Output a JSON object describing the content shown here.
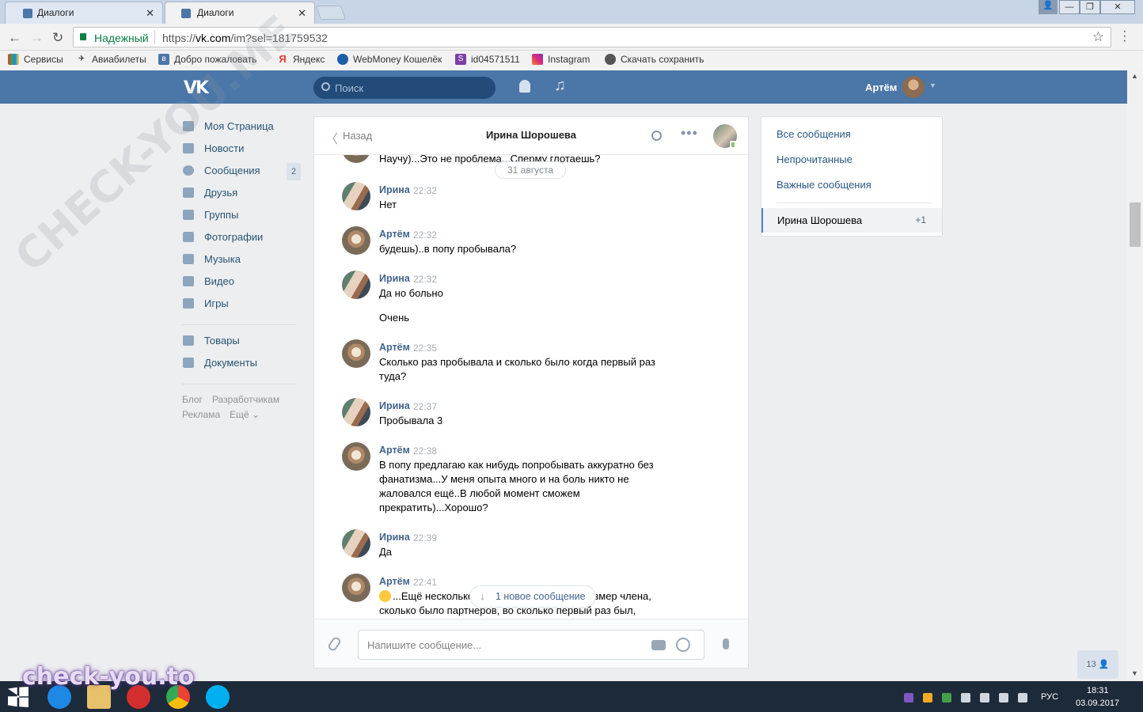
{
  "browser": {
    "tabs": [
      {
        "title": "Диалоги",
        "active": false
      },
      {
        "title": "Диалоги",
        "active": true
      }
    ],
    "secure_label": "Надежный",
    "url_scheme": "https://",
    "url_host": "vk.com",
    "url_path": "/im?sel=181759532",
    "bookmarks": [
      "Сервисы",
      "Авиабилеты",
      "Добро пожаловать",
      "Яндекс",
      "WebMoney Кошелёк",
      "id04571511",
      "Instagram",
      "Скачать сохранить"
    ]
  },
  "vk": {
    "search_placeholder": "Поиск",
    "username": "Артём",
    "menu": [
      {
        "label": "Моя Страница",
        "icon": "home-icon"
      },
      {
        "label": "Новости",
        "icon": "news-icon"
      },
      {
        "label": "Сообщения",
        "icon": "messages-icon",
        "badge": "2"
      },
      {
        "label": "Друзья",
        "icon": "friends-icon"
      },
      {
        "label": "Группы",
        "icon": "groups-icon"
      },
      {
        "label": "Фотографии",
        "icon": "photos-icon"
      },
      {
        "label": "Музыка",
        "icon": "music-icon"
      },
      {
        "label": "Видео",
        "icon": "video-icon"
      },
      {
        "label": "Игры",
        "icon": "games-icon"
      }
    ],
    "menu2": [
      {
        "label": "Товары",
        "icon": "goods-icon"
      },
      {
        "label": "Документы",
        "icon": "documents-icon"
      }
    ],
    "footer_links": [
      "Блог",
      "Разработчикам",
      "Реклама",
      "Ещё ⌄"
    ]
  },
  "chat": {
    "back_label": "Назад",
    "title": "Ирина Шорошева",
    "date_divider": "31 августа",
    "partial_top": "Научу)...Это не проблема...Сперму глотаешь?",
    "messages": [
      {
        "author": "Ирина",
        "time": "22:32",
        "text": "Нет"
      },
      {
        "author": "Артём",
        "time": "22:32",
        "text": "будешь)..в попу пробывала?"
      },
      {
        "author": "Ирина",
        "time": "22:32",
        "text": "Да но больно"
      },
      {
        "author": "",
        "time": "",
        "text": "Очень"
      },
      {
        "author": "Артём",
        "time": "22:35",
        "text": "Сколько раз пробывала и сколько было когда первый раз туда?"
      },
      {
        "author": "Ирина",
        "time": "22:37",
        "text": "Пробывала 3"
      },
      {
        "author": "Артём",
        "time": "22:38",
        "text": "В попу предлагаю как нибудь попробывать аккуратно без фанатизма...У меня опыта много и на боль никто не жаловался ещё..В любой момент сможем прекратить)...Хорошо?"
      },
      {
        "author": "Ирина",
        "time": "22:39",
        "text": "Да"
      },
      {
        "author": "Артём",
        "time": "22:41",
        "text": "...Ещё несколько вопросов) ...важен ли размер члена, сколько было партнеров, во сколько первый раз был,"
      }
    ],
    "new_message_pill": "1 новое сообщение",
    "composer_placeholder": "Напишите сообщение..."
  },
  "dialog_filters": {
    "items": [
      "Все сообщения",
      "Непрочитанные",
      "Важные сообщения"
    ],
    "selected_name": "Ирина Шорошева",
    "selected_count": "+1"
  },
  "friends_online": "13",
  "taskbar": {
    "lang": "РУС",
    "time": "18:31",
    "date": "03.09.2017"
  },
  "watermarks": [
    "check-you.to",
    "CHECK-YOU.ME"
  ],
  "colors": {
    "vk_blue": "#4a76a8",
    "link": "#2a5885",
    "author": "#42648b"
  }
}
